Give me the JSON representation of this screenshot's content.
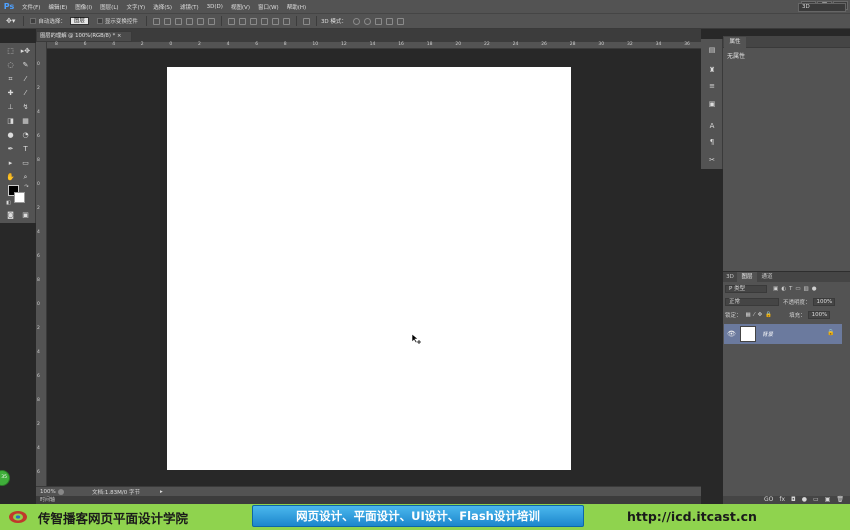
{
  "app": {
    "logo": "Ps"
  },
  "menubar": {
    "items": [
      "文件(F)",
      "编辑(E)",
      "图像(I)",
      "图层(L)",
      "文字(Y)",
      "选择(S)",
      "滤镜(T)",
      "3D(D)",
      "视图(V)",
      "窗口(W)",
      "帮助(H)"
    ]
  },
  "window_controls": {
    "minimize": "–",
    "restore": "❐",
    "close": "✕"
  },
  "options": {
    "auto_select_label": "自动选择：",
    "auto_select_value": "图层",
    "show_transform_label": "显示变换控件",
    "mode_3d_label": "3D 模式："
  },
  "workspace": {
    "value": "3D"
  },
  "document": {
    "tab_title": "图层的理解 @ 100%(RGB/8) *",
    "zoom": "100%",
    "info": "文档:1.83M/0 字节",
    "info_arrow": "▸"
  },
  "rulers": {
    "top_ticks": [
      "8",
      "6",
      "4",
      "2",
      "0",
      "2",
      "4",
      "6",
      "8",
      "10",
      "12",
      "14",
      "16",
      "18",
      "20",
      "22",
      "24",
      "26",
      "28",
      "30",
      "32",
      "34",
      "36"
    ],
    "left_ticks": [
      "0",
      "2",
      "4",
      "6",
      "8",
      "0",
      "2",
      "4",
      "6",
      "8",
      "0",
      "2",
      "4",
      "6",
      "8",
      "2",
      "4",
      "6"
    ]
  },
  "timeline_label": "时间轴",
  "properties": {
    "tab": "属性",
    "title": "无属性"
  },
  "layers": {
    "tabs": [
      "3D",
      "图层",
      "通道"
    ],
    "filter_value": "P 类型",
    "blend_mode": "正常",
    "opacity_label": "不透明度：",
    "opacity_value": "100%",
    "lock_label": "锁定：",
    "fill_label": "填充：",
    "fill_value": "100%",
    "layer_name": "背景",
    "bottom_icons": [
      "GO",
      "fx",
      "◘",
      "●",
      "▭",
      "▣",
      "🗑"
    ]
  },
  "badge": {
    "text": "35"
  },
  "banner": {
    "school": "传智播客网页平面设计学院",
    "courses": "网页设计、平面设计、UI设计、Flash设计培训",
    "url": "http://icd.itcast.cn"
  },
  "colors": {
    "ui_gray": "#535353",
    "pasteboard": "#282828",
    "banner_green": "#8fd34e",
    "banner_blue": "#1c86cc",
    "selected_layer": "#6b7a9e"
  }
}
